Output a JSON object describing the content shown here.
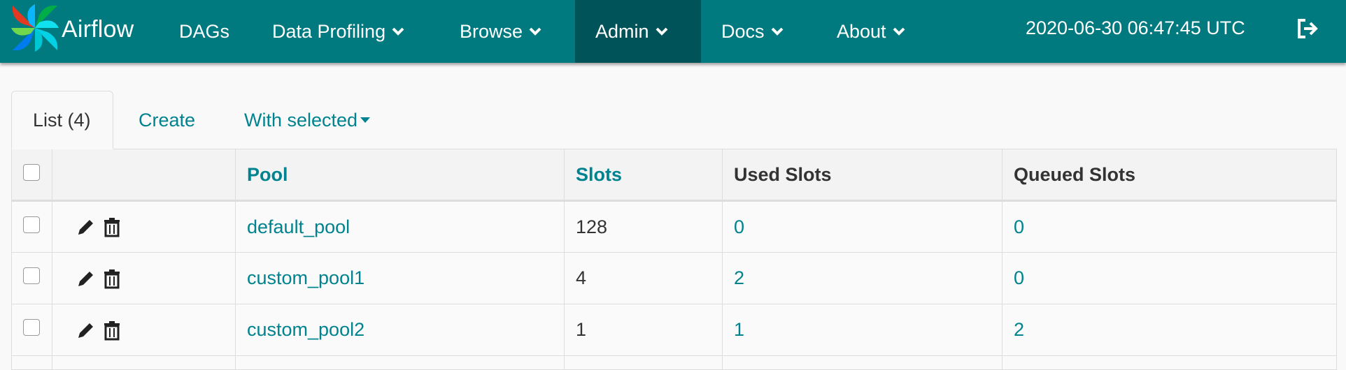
{
  "brand": {
    "name": "Airflow"
  },
  "nav": {
    "items": [
      {
        "label": "DAGs"
      },
      {
        "label": "Data Profiling"
      },
      {
        "label": "Browse"
      },
      {
        "label": "Admin"
      },
      {
        "label": "Docs"
      },
      {
        "label": "About"
      }
    ],
    "active": "Admin",
    "clock": "2020-06-30 06:47:45 UTC"
  },
  "icons": {
    "logout": "sign-out-icon",
    "edit": "pencil-icon",
    "delete": "trash-icon",
    "dropdown": "chevron-down-icon"
  },
  "tabs": {
    "list_label": "List (4)",
    "create_label": "Create",
    "with_selected_label": "With selected"
  },
  "table": {
    "headers": {
      "pool": "Pool",
      "slots": "Slots",
      "used_slots": "Used Slots",
      "queued_slots": "Queued Slots"
    },
    "rows": [
      {
        "pool": "default_pool",
        "slots": "128",
        "used_slots": "0",
        "queued_slots": "0"
      },
      {
        "pool": "custom_pool1",
        "slots": "4",
        "used_slots": "2",
        "queued_slots": "0"
      },
      {
        "pool": "custom_pool2",
        "slots": "1",
        "used_slots": "1",
        "queued_slots": "2"
      }
    ]
  },
  "colors": {
    "navbar": "#00797f",
    "navbar_active": "#005359",
    "link": "#00838f"
  }
}
